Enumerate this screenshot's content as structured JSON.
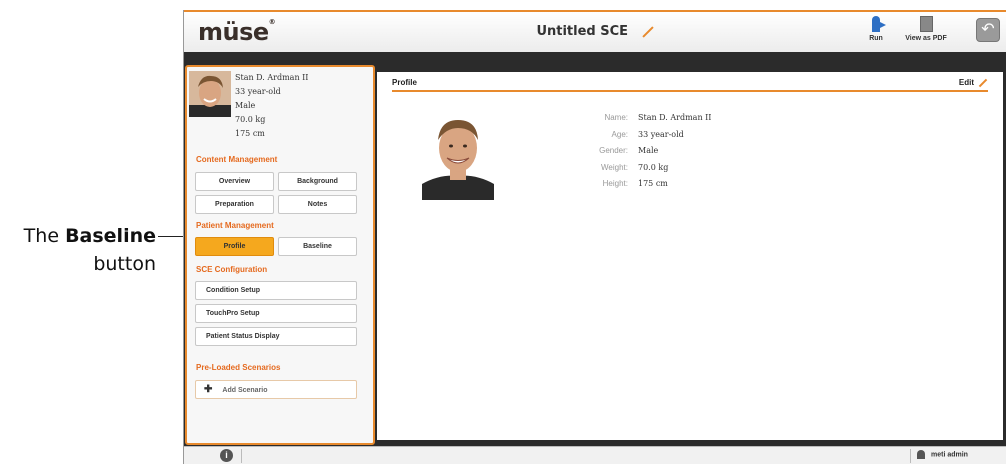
{
  "callout": {
    "prefix": "The ",
    "bold": "Baseline",
    "line2": "button"
  },
  "app": {
    "logo": "müse",
    "logo_mark": "®",
    "title": "Untitled SCE",
    "toolbar": {
      "run_label": "Run",
      "pdf_label": "View as PDF"
    },
    "accent_color": "#e88a2d"
  },
  "patient": {
    "name": "Stan D. Ardman II",
    "age": "33 year-old",
    "gender": "Male",
    "weight": "70.0 kg",
    "height": "175 cm"
  },
  "sidebar": {
    "content_management": {
      "title": "Content Management",
      "buttons": [
        "Overview",
        "Background",
        "Preparation",
        "Notes"
      ]
    },
    "patient_management": {
      "title": "Patient Management",
      "buttons": [
        "Profile",
        "Baseline"
      ],
      "active": "Profile"
    },
    "sce_configuration": {
      "title": "SCE Configuration",
      "buttons": [
        "Condition Setup",
        "TouchPro Setup",
        "Patient Status Display"
      ]
    },
    "preloaded": {
      "title": "Pre-Loaded Scenarios",
      "add_label": "Add Scenario"
    }
  },
  "main": {
    "panel_title": "Profile",
    "edit_label": "Edit",
    "labels": {
      "name": "Name:",
      "age": "Age:",
      "gender": "Gender:",
      "weight": "Weight:",
      "height": "Height:"
    }
  },
  "footer": {
    "user": "meti admin"
  }
}
